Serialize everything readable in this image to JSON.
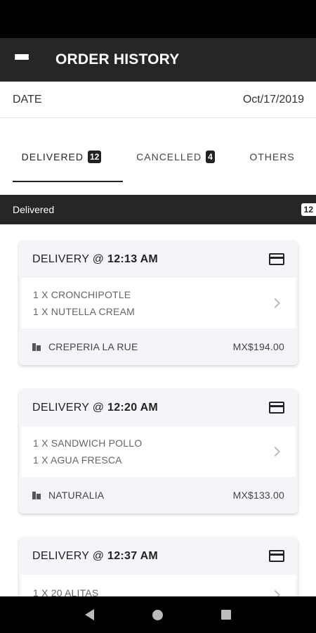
{
  "app_bar": {
    "title": "ORDER HISTORY",
    "menu_icon": "hamburger-menu-icon"
  },
  "date_row": {
    "label": "DATE",
    "value": "Oct/17/2019"
  },
  "tabs": [
    {
      "label": "DELIVERED",
      "badge": "12",
      "active": true
    },
    {
      "label": "CANCELLED",
      "badge": "4",
      "active": false
    },
    {
      "label": "OTHERS",
      "badge": "",
      "active": false
    }
  ],
  "section": {
    "label": "Delivered",
    "count": "12"
  },
  "orders": [
    {
      "prefix": "DELIVERY @ ",
      "time": "12:13 AM",
      "items": [
        "1 X CRONCHIPOTLE",
        "1 X NUTELLA CREAM"
      ],
      "store": "CREPERIA LA RUE",
      "price": "MX$194.00",
      "payment_icon": "credit-card-icon"
    },
    {
      "prefix": "DELIVERY @ ",
      "time": "12:20 AM",
      "items": [
        "1 X SANDWICH POLLO",
        "1 X AGUA FRESCA"
      ],
      "store": "NATURALIA",
      "price": "MX$133.00",
      "payment_icon": "credit-card-icon"
    },
    {
      "prefix": "DELIVERY @ ",
      "time": "12:37 AM",
      "items": [
        "1 X 20 ALITAS",
        ""
      ],
      "store": "",
      "price": "",
      "payment_icon": "credit-card-icon"
    }
  ],
  "colors": {
    "app_bar": "#262626",
    "card_bg": "#f4f5f8",
    "status_bar": "#000000"
  },
  "nav": {
    "back_icon": "back-icon",
    "home_icon": "home-icon",
    "recents_icon": "recents-icon"
  }
}
